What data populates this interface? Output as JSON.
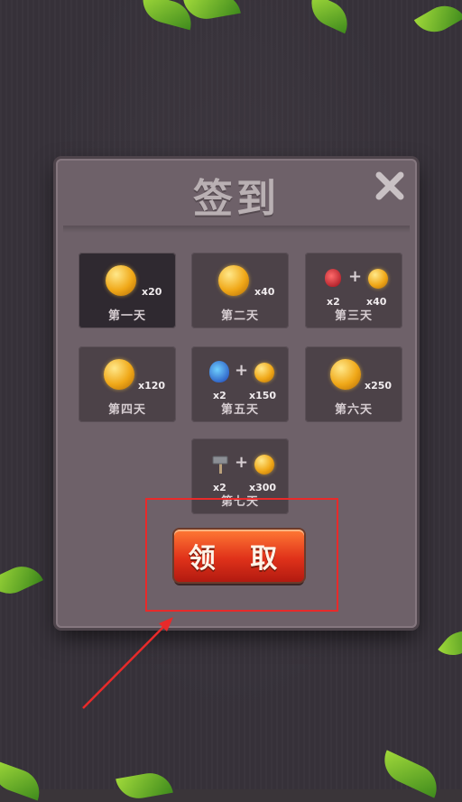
{
  "dialog": {
    "title": "签到",
    "claim_label": "领 取"
  },
  "days": [
    {
      "label": "第一天",
      "reward": "x20"
    },
    {
      "label": "第二天",
      "reward": "x40"
    },
    {
      "label": "第三天",
      "potion_qty": "x2",
      "coin_qty": "x40"
    },
    {
      "label": "第四天",
      "reward": "x120"
    },
    {
      "label": "第五天",
      "potion_qty": "x2",
      "coin_qty": "x150"
    },
    {
      "label": "第六天",
      "reward": "x250"
    },
    {
      "label": "第七天",
      "hammer_qty": "x2",
      "coin_qty": "x300"
    }
  ],
  "icons": {
    "close": "close-icon",
    "coin": "gold-coin-icon",
    "red_potion": "red-potion-icon",
    "blue_potion": "blue-potion-icon",
    "hammer": "hammer-icon"
  },
  "colors": {
    "highlight": "#e82a2a",
    "claim_button": "#e0321a"
  }
}
